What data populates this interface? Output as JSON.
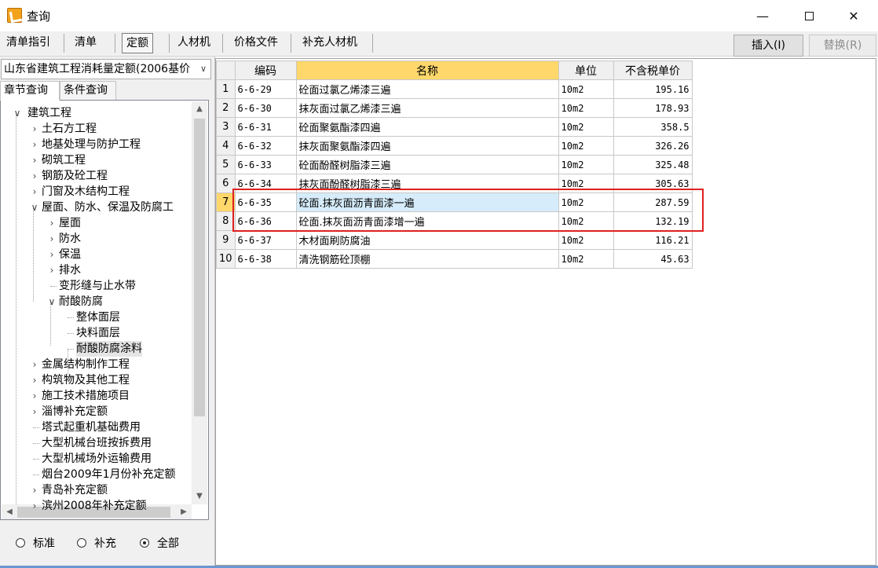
{
  "window": {
    "title": "查询",
    "minimize": "—",
    "close": "✕"
  },
  "tabs": [
    "清单指引",
    "清单",
    "定额",
    "人材机",
    "价格文件",
    "补充人材机"
  ],
  "buttons": {
    "insert": "插入(I)",
    "replace": "替换(R)"
  },
  "left": {
    "dropdown_value": "山东省建筑工程消耗量定额(2006基价",
    "dropdown_arrow": "∨",
    "subtabs": [
      "章节查询",
      "条件查询"
    ],
    "tree": [
      {
        "label": "建筑工程",
        "level": 0,
        "toggle": "∨"
      },
      {
        "label": "土石方工程",
        "level": 1,
        "toggle": "›"
      },
      {
        "label": "地基处理与防护工程",
        "level": 1,
        "toggle": "›"
      },
      {
        "label": "砌筑工程",
        "level": 1,
        "toggle": "›"
      },
      {
        "label": "钢筋及砼工程",
        "level": 1,
        "toggle": "›"
      },
      {
        "label": "门窗及木结构工程",
        "level": 1,
        "toggle": "›"
      },
      {
        "label": "屋面、防水、保温及防腐工",
        "level": 1,
        "toggle": "∨"
      },
      {
        "label": "屋面",
        "level": 2,
        "toggle": "›"
      },
      {
        "label": "防水",
        "level": 2,
        "toggle": "›"
      },
      {
        "label": "保温",
        "level": 2,
        "toggle": "›"
      },
      {
        "label": "排水",
        "level": 2,
        "toggle": "›"
      },
      {
        "label": "变形缝与止水带",
        "level": 2,
        "toggle": ""
      },
      {
        "label": "耐酸防腐",
        "level": 2,
        "toggle": "∨"
      },
      {
        "label": "整体面层",
        "level": 3,
        "toggle": ""
      },
      {
        "label": "块料面层",
        "level": 3,
        "toggle": ""
      },
      {
        "label": "耐酸防腐涂料",
        "level": 3,
        "toggle": "",
        "selected": true
      },
      {
        "label": "金属结构制作工程",
        "level": 1,
        "toggle": "›"
      },
      {
        "label": "构筑物及其他工程",
        "level": 1,
        "toggle": "›"
      },
      {
        "label": "施工技术措施项目",
        "level": 1,
        "toggle": "›"
      },
      {
        "label": "淄博补充定额",
        "level": 1,
        "toggle": "›"
      },
      {
        "label": "塔式起重机基础费用",
        "level": 1,
        "toggle": ""
      },
      {
        "label": "大型机械台班按拆费用",
        "level": 1,
        "toggle": ""
      },
      {
        "label": "大型机械场外运输费用",
        "level": 1,
        "toggle": ""
      },
      {
        "label": "烟台2009年1月份补充定额",
        "level": 1,
        "toggle": ""
      },
      {
        "label": "青岛补充定额",
        "level": 1,
        "toggle": "›"
      },
      {
        "label": "滨州2008年补充定额",
        "level": 1,
        "toggle": "›"
      }
    ],
    "radios": [
      {
        "label": "标准",
        "checked": false
      },
      {
        "label": "补充",
        "checked": false
      },
      {
        "label": "全部",
        "checked": true
      }
    ]
  },
  "grid": {
    "headers": [
      "",
      "编码",
      "名称",
      "单位",
      "不含税单价"
    ],
    "rows": [
      {
        "no": "1",
        "code": "6-6-29",
        "name": "砼面过氯乙烯漆三遍",
        "unit": "10m2",
        "price": "195.16"
      },
      {
        "no": "2",
        "code": "6-6-30",
        "name": "抹灰面过氯乙烯漆三遍",
        "unit": "10m2",
        "price": "178.93"
      },
      {
        "no": "3",
        "code": "6-6-31",
        "name": "砼面聚氨酯漆四遍",
        "unit": "10m2",
        "price": "358.5"
      },
      {
        "no": "4",
        "code": "6-6-32",
        "name": "抹灰面聚氨酯漆四遍",
        "unit": "10m2",
        "price": "326.26"
      },
      {
        "no": "5",
        "code": "6-6-33",
        "name": "砼面酚醛树脂漆三遍",
        "unit": "10m2",
        "price": "325.48"
      },
      {
        "no": "6",
        "code": "6-6-34",
        "name": "抹灰面酚醛树脂漆三遍",
        "unit": "10m2",
        "price": "305.63"
      },
      {
        "no": "7",
        "code": "6-6-35",
        "name": "砼面.抹灰面沥青面漆一遍",
        "unit": "10m2",
        "price": "287.59",
        "current": true
      },
      {
        "no": "8",
        "code": "6-6-36",
        "name": "砼面.抹灰面沥青面漆增一遍",
        "unit": "10m2",
        "price": "132.19"
      },
      {
        "no": "9",
        "code": "6-6-37",
        "name": "木材面刷防腐油",
        "unit": "10m2",
        "price": "116.21"
      },
      {
        "no": "10",
        "code": "6-6-38",
        "name": "清洗钢筋砼顶棚",
        "unit": "10m2",
        "price": "45.63"
      }
    ]
  },
  "colors": {
    "highlight_box": "#e02020",
    "header_active": "#ffd76b",
    "row_selected": "#d6ecfa"
  }
}
